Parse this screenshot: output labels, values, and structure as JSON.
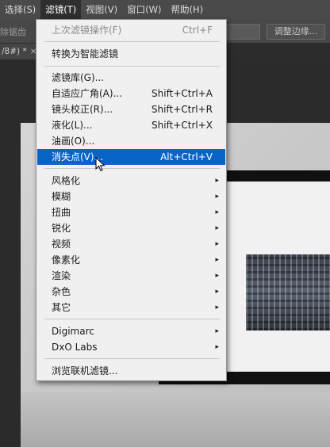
{
  "menubar": {
    "items": [
      "选择(S)",
      "滤镜(T)",
      "视图(V)",
      "窗口(W)",
      "帮助(H)"
    ],
    "active_index": 1
  },
  "options": {
    "left_text": "除锯齿",
    "refine_button": "调整边缘..."
  },
  "tab": {
    "label": "/8#) *",
    "close": "×"
  },
  "filter_menu": {
    "last_filter": {
      "label": "上次滤镜操作(F)",
      "shortcut": "Ctrl+F"
    },
    "smart": "转换为智能滤镜",
    "filter_gallery": "滤镜库(G)...",
    "adaptive_wide": {
      "label": "自适应广角(A)...",
      "shortcut": "Shift+Ctrl+A"
    },
    "lens_correction": {
      "label": "镜头校正(R)...",
      "shortcut": "Shift+Ctrl+R"
    },
    "liquify": {
      "label": "液化(L)...",
      "shortcut": "Shift+Ctrl+X"
    },
    "oil_paint": "油画(O)...",
    "vanishing_point": {
      "label": "消失点(V)...",
      "shortcut": "Alt+Ctrl+V"
    },
    "submenus": [
      "风格化",
      "模糊",
      "扭曲",
      "锐化",
      "视频",
      "像素化",
      "渲染",
      "杂色",
      "其它"
    ],
    "plugins": [
      "Digimarc",
      "DxO Labs"
    ],
    "browse_online": "浏览联机滤镜...",
    "arrow": "▸"
  },
  "colors": {
    "highlight": "#0a64c8",
    "menu_bg": "#f0f0f0"
  }
}
